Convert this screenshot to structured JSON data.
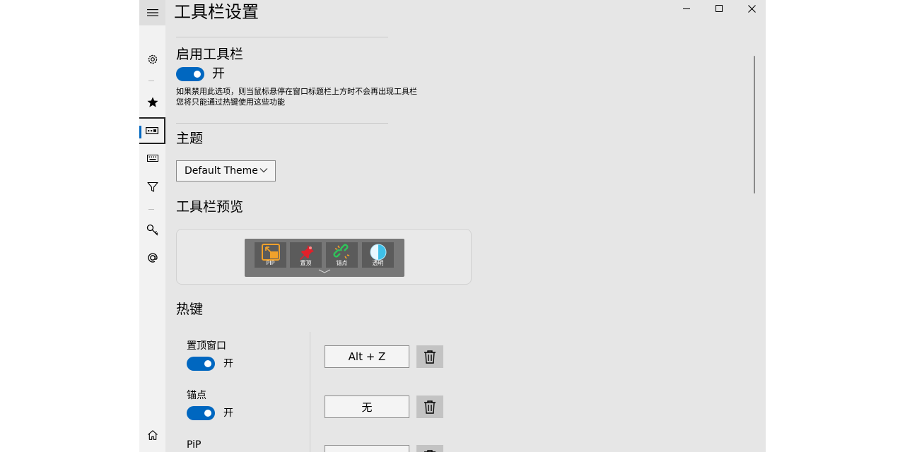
{
  "page": {
    "title": "工具栏设置"
  },
  "nav": {
    "items": [
      {
        "icon": "hamburger-menu-icon"
      },
      {
        "icon": "gear-icon"
      },
      {
        "icon": "star-icon"
      },
      {
        "icon": "toolbar-icon",
        "selected": true
      },
      {
        "icon": "keyboard-icon"
      },
      {
        "icon": "filter-icon"
      },
      {
        "icon": "key-icon"
      },
      {
        "icon": "at-icon"
      },
      {
        "icon": "home-icon"
      }
    ]
  },
  "window_controls": [
    "minimize-icon",
    "maximize-icon",
    "close-icon"
  ],
  "enable_toolbar": {
    "heading": "启用工具栏",
    "state_label": "开",
    "enabled": true,
    "desc_line1": "如果禁用此选项，则当鼠标悬停在窗口标题栏上方时不会再出现工具栏",
    "desc_line2": "您将只能通过热键使用这些功能"
  },
  "theme": {
    "heading": "主题",
    "selected": "Default Theme"
  },
  "preview": {
    "heading": "工具栏预览",
    "buttons": [
      {
        "label": "PIP",
        "icon": "pip-icon"
      },
      {
        "label": "置顶",
        "icon": "pin-icon"
      },
      {
        "label": "锚点",
        "icon": "anchor-link-icon"
      },
      {
        "label": "透明",
        "icon": "transparency-icon"
      }
    ]
  },
  "hotkeys": {
    "heading": "热键",
    "items": [
      {
        "name": "置顶窗口",
        "state_label": "开",
        "enabled": true,
        "key": "Alt + Z"
      },
      {
        "name": "锚点",
        "state_label": "开",
        "enabled": true,
        "key": "无"
      },
      {
        "name": "PiP",
        "state_label": "",
        "enabled": true,
        "key": ""
      }
    ]
  },
  "colors": {
    "accent": "#0067c0",
    "background": "#e6e6e6",
    "nav_background": "#f2f2f2"
  }
}
